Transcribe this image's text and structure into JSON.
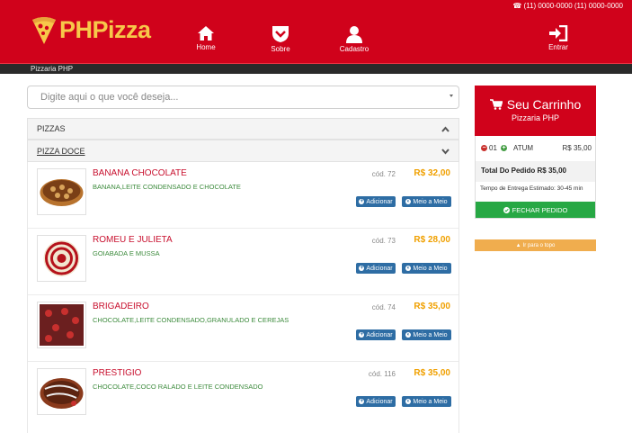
{
  "header": {
    "phones": "☎ (11) 0000-0000   (11) 0000-0000",
    "logo": "PHPizza",
    "nav": [
      {
        "label": "Home",
        "icon": "home-icon"
      },
      {
        "label": "Sobre",
        "icon": "shield-icon"
      },
      {
        "label": "Cadastro",
        "icon": "user-icon"
      },
      {
        "label": "Entrar",
        "icon": "sign-in-icon"
      }
    ],
    "subtitle": "Pizzaria PHP"
  },
  "search": {
    "placeholder": "Digite aqui o que você deseja..."
  },
  "categories": {
    "pizzas": "PIZZAS",
    "pizza_doce": "PIZZA DOCE"
  },
  "buttons": {
    "add": "Adicionar",
    "half": "Meio a Meio"
  },
  "products": [
    {
      "name": "BANANA CHOCOLATE",
      "desc": "BANANA,LEITE CONDENSADO E CHOCOLATE",
      "code": "cód. 72",
      "price": "R$ 32,00"
    },
    {
      "name": "ROMEU E JULIETA",
      "desc": "GOIABADA E MUSSA",
      "code": "cód. 73",
      "price": "R$ 28,00"
    },
    {
      "name": "BRIGADEIRO",
      "desc": "CHOCOLATE,LEITE CONDENSADO,GRANULADO E CEREJAS",
      "code": "cód. 74",
      "price": "R$ 35,00"
    },
    {
      "name": "PRESTIGIO",
      "desc": "CHOCOLATE,COCO RALADO E LEITE CONDENSADO",
      "code": "cód. 116",
      "price": "R$ 35,00"
    }
  ],
  "cart": {
    "title": "Seu Carrinho",
    "subtitle": "Pizzaria PHP",
    "item": {
      "qty": "01",
      "name": "ATUM",
      "price": "R$ 35,00"
    },
    "total": "Total Do Pedido R$ 35,00",
    "time": "Tempo de Entrega Estimado: 30-45 min",
    "close": "FECHAR PEDIDO",
    "back_top": "Ir para o topo"
  },
  "colors": {
    "brand": "#d0021b",
    "logo": "#f7c84a",
    "button": "#2e6da4",
    "price": "#f0a000",
    "close": "#27a844"
  }
}
